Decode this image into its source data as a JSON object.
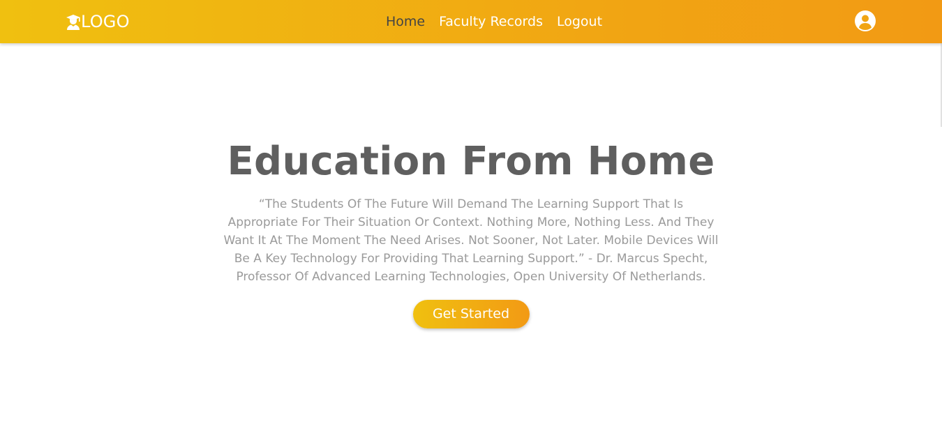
{
  "header": {
    "logo_text": "LOGO",
    "logo_icon": "graduate-icon",
    "nav": [
      {
        "label": "Home",
        "active": true
      },
      {
        "label": "Faculty Records",
        "active": false
      },
      {
        "label": "Logout",
        "active": false
      }
    ],
    "user_icon": "user-circle-icon"
  },
  "hero": {
    "title": "Education From Home",
    "quote": "“The Students Of The Future Will Demand The Learning Support That Is Appropriate For Their Situation Or Context. Nothing More, Nothing Less. And They Want It At The Moment The Need Arises. Not Sooner, Not Later. Mobile Devices Will Be A Key Technology For Providing That Learning Support.” - Dr. Marcus Specht, Professor Of Advanced Learning Technologies, Open University Of Netherlands.",
    "cta_label": "Get Started"
  },
  "colors": {
    "brand_start": "#f0c010",
    "brand_end": "#f29a14",
    "title_text": "#5f5f5f",
    "body_text": "#9a9a9a",
    "active_nav": "#444444"
  }
}
